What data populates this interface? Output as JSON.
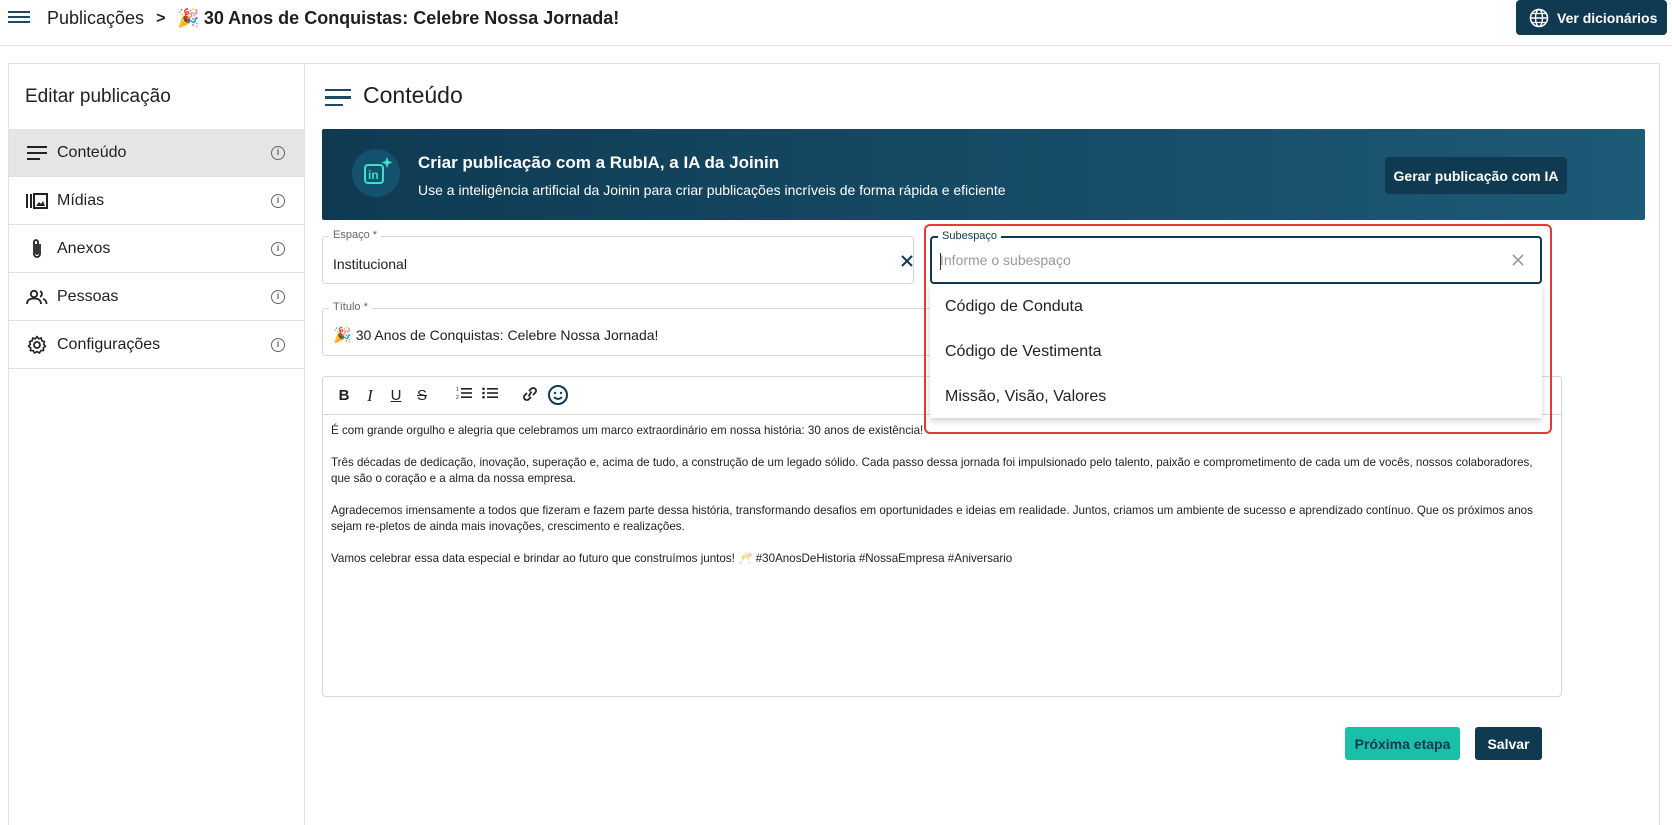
{
  "topbar": {
    "breadcrumb_root": "Publicações",
    "breadcrumb_emoji": "🎉",
    "breadcrumb_current": "30 Anos de Conquistas: Celebre Nossa Jornada!",
    "dict_button": "Ver dicionários"
  },
  "sidebar": {
    "title": "Editar publicação",
    "items": [
      {
        "label": "Conteúdo",
        "icon": "lines-icon",
        "active": true
      },
      {
        "label": "Mídias",
        "icon": "media-icon"
      },
      {
        "label": "Anexos",
        "icon": "paperclip-icon"
      },
      {
        "label": "Pessoas",
        "icon": "people-icon"
      },
      {
        "label": "Configurações",
        "icon": "gear-icon"
      }
    ]
  },
  "main": {
    "heading": "Conteúdo",
    "ai_banner": {
      "title": "Criar publicação com a RubIA, a IA da Joinin",
      "subtitle": "Use a inteligência artificial da Joinin para criar publicações incríveis de forma rápida e eficiente",
      "button": "Gerar publicação com IA"
    },
    "espaco": {
      "label": "Espaço *",
      "value": "Institucional"
    },
    "subespaco": {
      "label": "Subespaço",
      "placeholder": "Informe o subespaço",
      "options": [
        "Código de Conduta",
        "Código de Vestimenta",
        "Missão, Visão, Valores"
      ]
    },
    "titulo": {
      "label": "Título *",
      "emoji": "🎉",
      "value": "30 Anos de Conquistas: Celebre Nossa Jornada!"
    },
    "editor": {
      "paragraphs": [
        "É com grande orgulho e alegria que celebramos um marco extraordinário em nossa história: 30 anos de existência!",
        "Três décadas de dedicação, inovação, superação e, acima de tudo, a construção de um legado sólido. Cada passo dessa jornada foi impulsionado pelo talento, paixão e comprometimento de cada um de vocês, nossos colaboradores, que são o coração e a alma da nossa empresa.",
        "Agradecemos imensamente a todos que fizeram e fazem parte dessa história, transformando desafios em oportunidades e ideias em realidade. Juntos, criamos um ambiente de sucesso e aprendizado contínuo. Que os próximos anos sejam re-pletos de ainda mais inovações, crescimento e realizações.",
        "Vamos celebrar essa data especial e brindar ao futuro que construímos juntos! 🥂 #30AnosDeHistoria #NossaEmpresa #Aniversario"
      ]
    },
    "buttons": {
      "next": "Próxima etapa",
      "save": "Salvar"
    }
  },
  "colors": {
    "primary": "#0f3a52",
    "accent": "#19bfa6",
    "highlight": "#e53935"
  }
}
